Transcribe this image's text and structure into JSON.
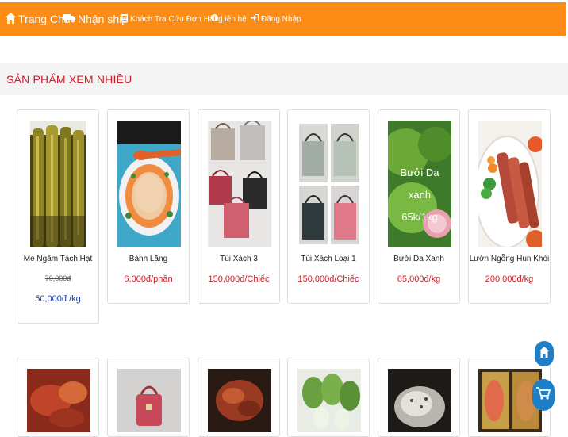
{
  "nav": {
    "home": "Trang Chủ",
    "ship": "Nhận ship",
    "track": "Khách Tra Cứu Đơn Hàng",
    "contact": "Liên hệ",
    "login": "Đăng Nhập",
    "icons": [
      "home-icon",
      "truck-icon",
      "document-icon",
      "info-icon",
      "sign-in-icon"
    ]
  },
  "section": {
    "title": "SẢN PHẨM XEM NHIỀU"
  },
  "products": [
    {
      "name": "Me Ngâm Tách Hạt",
      "old_price": "70,000đ",
      "price": "50,000đ /kg"
    },
    {
      "name": "Bánh Lăng",
      "price": "6,000đ/phần"
    },
    {
      "name": "Túi Xách 3",
      "price": "150,000đ/Chiếc"
    },
    {
      "name": "Túi Xách Loại 1",
      "price": "150,000đ/Chiếc"
    },
    {
      "name": "Bưởi Da Xanh",
      "price": "65,000đ/kg",
      "image_text": [
        "Bưởi Da",
        "xanh",
        "65k/1kg"
      ]
    },
    {
      "name": "Lườn Ngỗng Hun Khói",
      "price": "200,000đ/kg"
    }
  ],
  "colors": {
    "nav": "#fb8c16",
    "price": "#c8202a",
    "discount_price": "#1b3fa8",
    "fab": "#1e7fc6"
  },
  "fabs": [
    "home-icon",
    "cart-icon"
  ]
}
